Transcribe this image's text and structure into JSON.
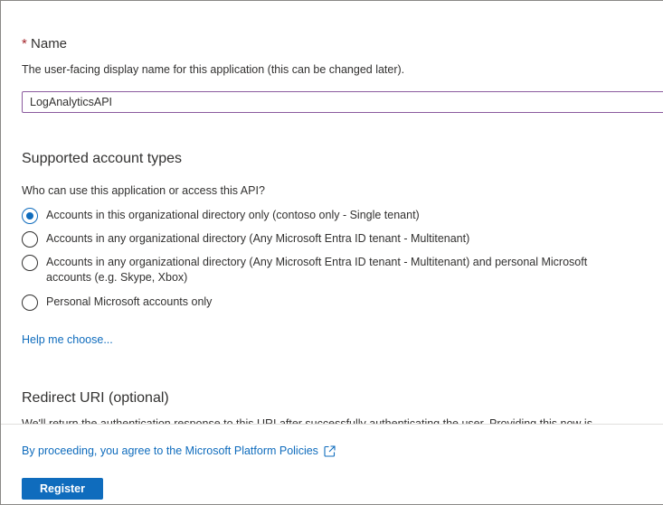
{
  "name_section": {
    "required_marker": "*",
    "heading": "Name",
    "description": "The user-facing display name for this application (this can be changed later).",
    "input_value": "LogAnalyticsAPI"
  },
  "accounts_section": {
    "heading": "Supported account types",
    "question": "Who can use this application or access this API?",
    "options": [
      {
        "label": "Accounts in this organizational directory only (contoso only - Single tenant)",
        "selected": true
      },
      {
        "label": "Accounts in any organizational directory (Any Microsoft Entra ID tenant - Multitenant)",
        "selected": false
      },
      {
        "label": "Accounts in any organizational directory (Any Microsoft Entra ID tenant - Multitenant) and personal Microsoft accounts (e.g. Skype, Xbox)",
        "selected": false
      },
      {
        "label": "Personal Microsoft accounts only",
        "selected": false
      }
    ],
    "help_link": "Help me choose..."
  },
  "redirect_section": {
    "heading": "Redirect URI (optional)",
    "description_partial": "We'll return the authentication response to this URI after successfully authenticating the user. Providing this now is"
  },
  "footer": {
    "policy_text": "By proceeding, you agree to the Microsoft Platform Policies",
    "policy_icon": "external-link-icon",
    "register_label": "Register"
  },
  "colors": {
    "accent": "#0f6cbd",
    "required": "#a4262c",
    "input_focus_border": "#8b5a9e"
  }
}
